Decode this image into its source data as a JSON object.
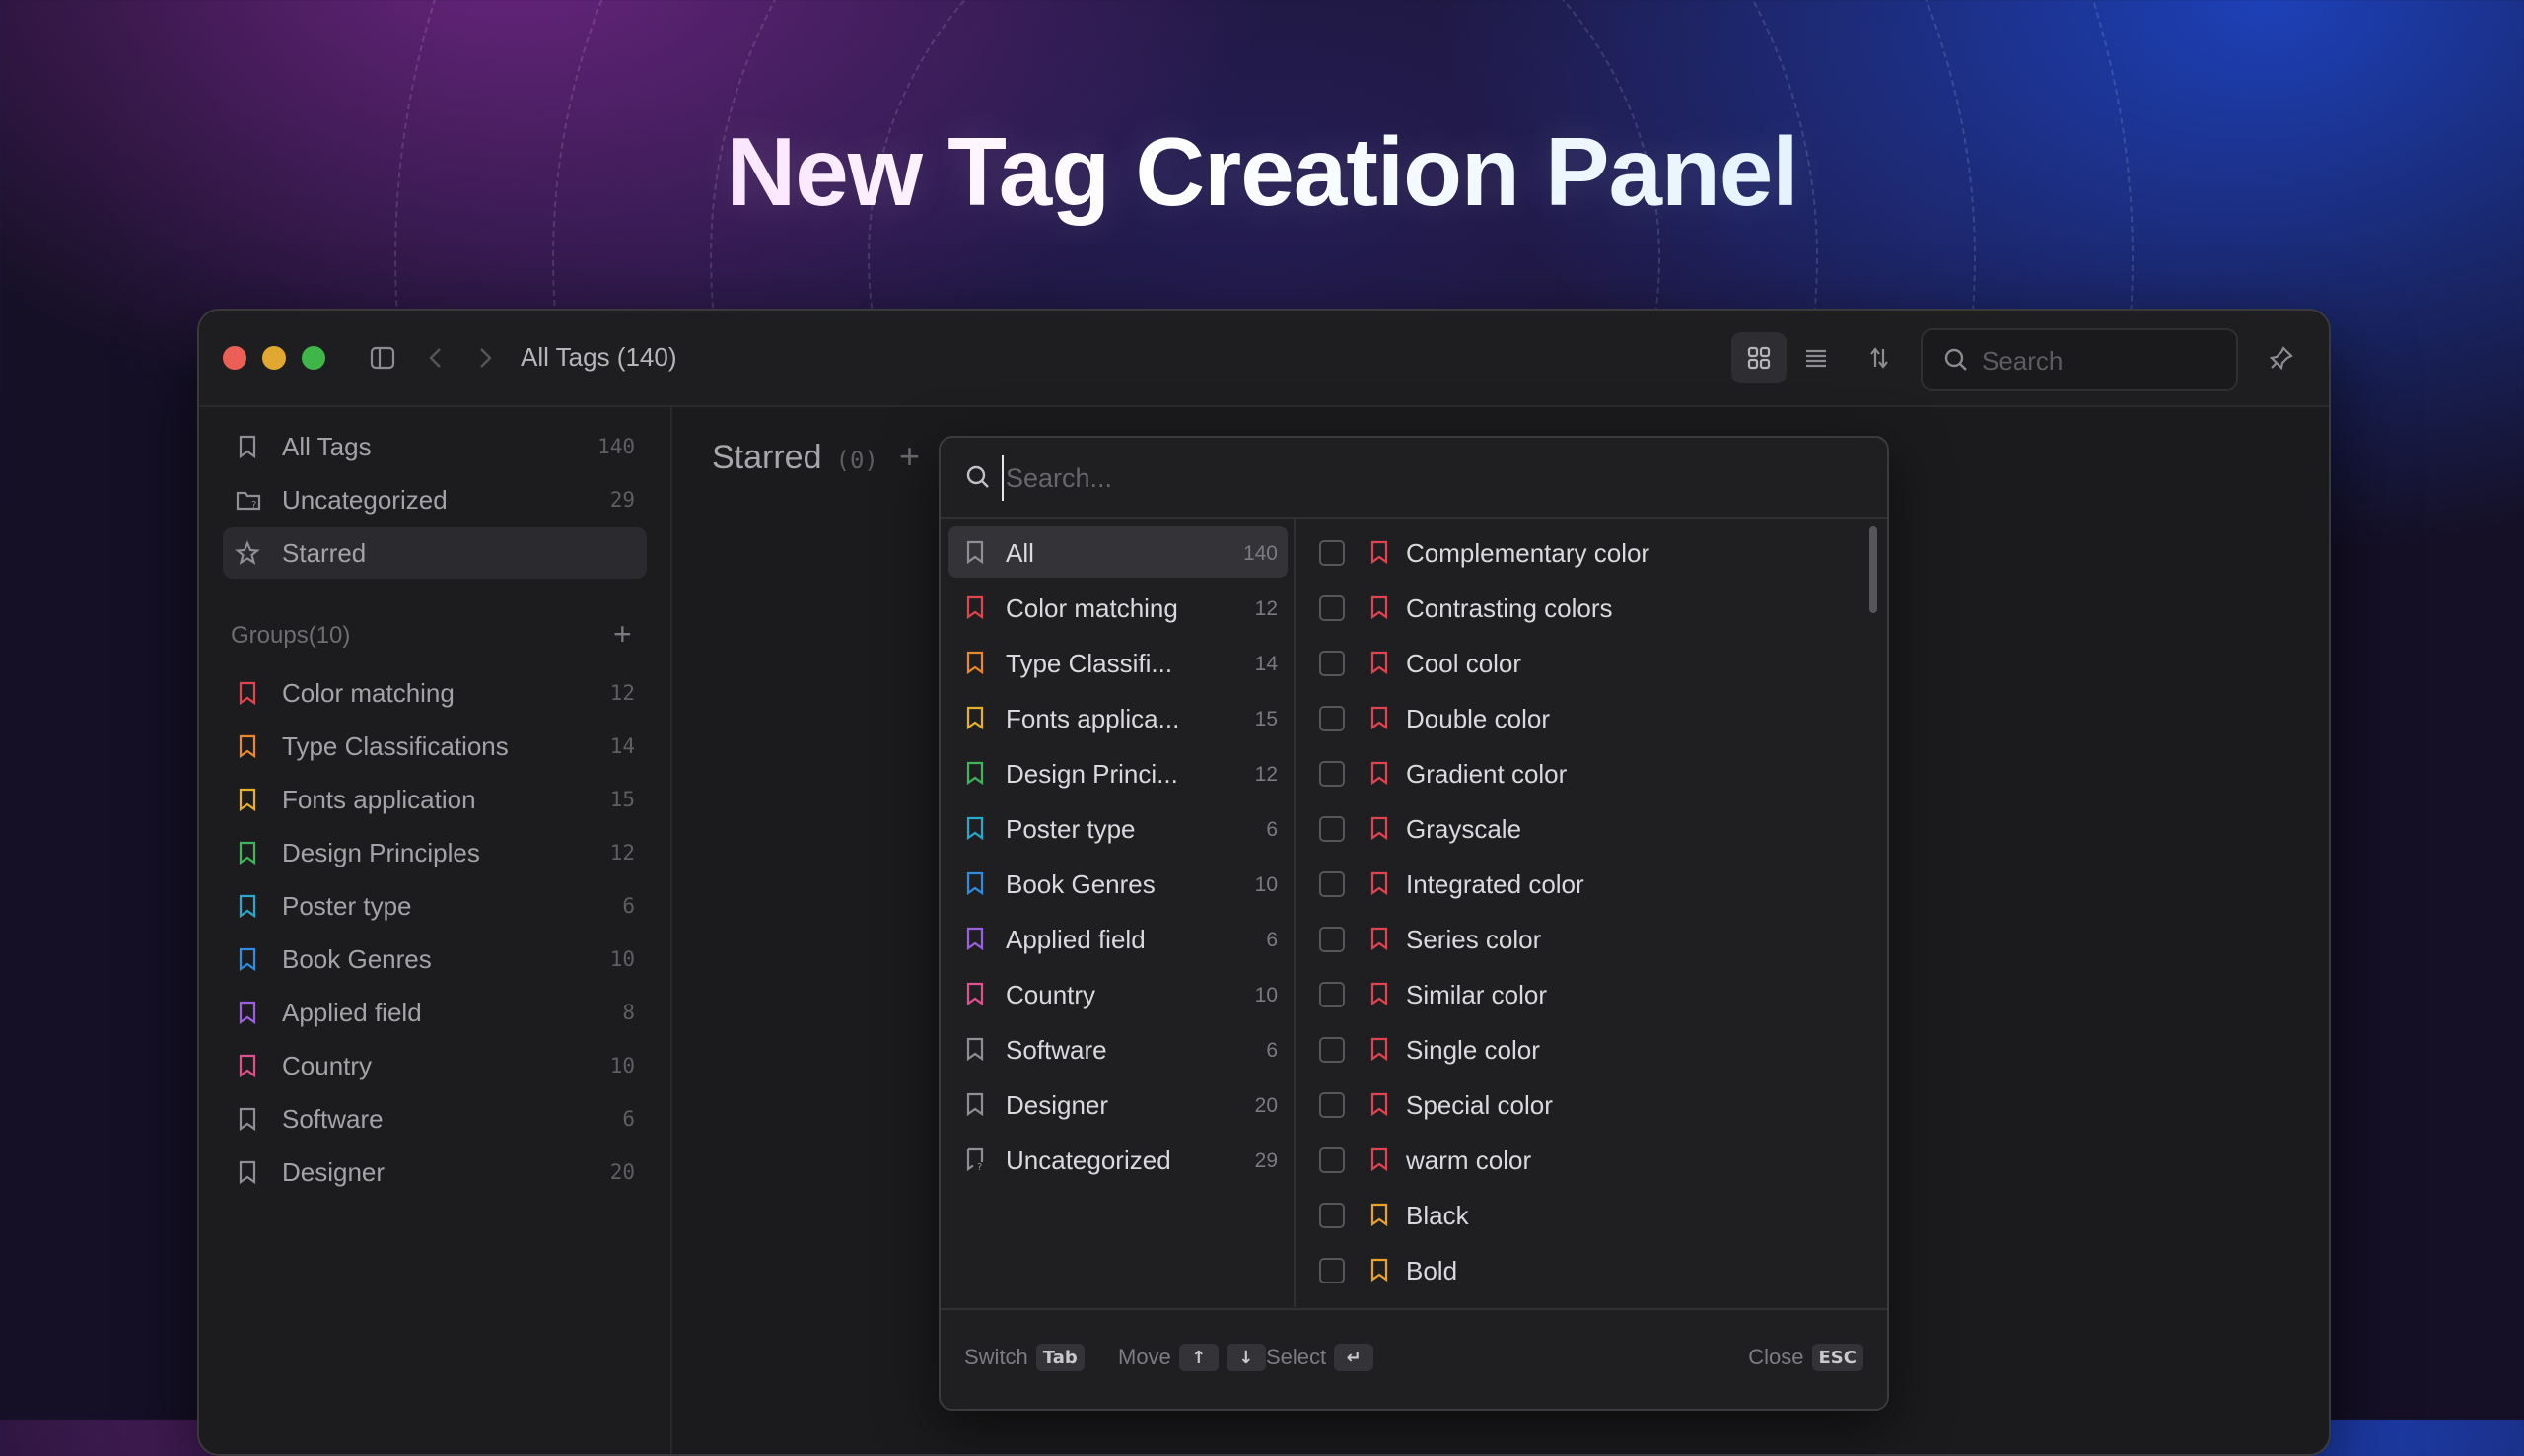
{
  "hero": {
    "title": "New Tag Creation Panel"
  },
  "window": {
    "title": "All Tags (140)",
    "search_placeholder": "Search"
  },
  "sidebar": {
    "top": [
      {
        "label": "All Tags",
        "count": "140",
        "icon": "bookmark-icon"
      },
      {
        "label": "Uncategorized",
        "count": "29",
        "icon": "folder-question-icon"
      },
      {
        "label": "Starred",
        "count": "",
        "icon": "star-icon"
      }
    ],
    "groups_label": "Groups(10)",
    "groups": [
      {
        "label": "Color matching",
        "count": "12",
        "color": "#e0454f"
      },
      {
        "label": "Type Classifications",
        "count": "14",
        "color": "#e8882a"
      },
      {
        "label": "Fonts application",
        "count": "15",
        "color": "#e6b02a"
      },
      {
        "label": "Design Principles",
        "count": "12",
        "color": "#3fb45a"
      },
      {
        "label": "Poster type",
        "count": "6",
        "color": "#2aa7c9"
      },
      {
        "label": "Book Genres",
        "count": "10",
        "color": "#2f8de0"
      },
      {
        "label": "Applied field",
        "count": "8",
        "color": "#9b5fe0"
      },
      {
        "label": "Country",
        "count": "10",
        "color": "#e0508f"
      },
      {
        "label": "Software",
        "count": "6",
        "color": "#8e8e94"
      },
      {
        "label": "Designer",
        "count": "20",
        "color": "#8e8e94"
      }
    ]
  },
  "main": {
    "title": "Starred",
    "count": "(0)"
  },
  "panel": {
    "search_placeholder": "Search...",
    "groups": [
      {
        "label": "All",
        "count": "140",
        "color": "#8e8e94"
      },
      {
        "label": "Color matching",
        "count": "12",
        "color": "#e0454f"
      },
      {
        "label": "Type Classifi...",
        "count": "14",
        "color": "#e8882a"
      },
      {
        "label": "Fonts applica...",
        "count": "15",
        "color": "#e6b02a"
      },
      {
        "label": "Design Princi...",
        "count": "12",
        "color": "#3fb45a"
      },
      {
        "label": "Poster type",
        "count": "6",
        "color": "#2aa7c9"
      },
      {
        "label": "Book Genres",
        "count": "10",
        "color": "#2f8de0"
      },
      {
        "label": "Applied field",
        "count": "6",
        "color": "#9b5fe0"
      },
      {
        "label": "Country",
        "count": "10",
        "color": "#e0508f"
      },
      {
        "label": "Software",
        "count": "6",
        "color": "#8e8e94"
      },
      {
        "label": "Designer",
        "count": "20",
        "color": "#8e8e94"
      },
      {
        "label": "Uncategorized",
        "count": "29",
        "color": "#8e8e94"
      }
    ],
    "tags": [
      {
        "label": "Complementary color",
        "color": "#e0454f"
      },
      {
        "label": "Contrasting colors",
        "color": "#e0454f"
      },
      {
        "label": "Cool color",
        "color": "#e0454f"
      },
      {
        "label": "Double color",
        "color": "#e0454f"
      },
      {
        "label": "Gradient color",
        "color": "#e0454f"
      },
      {
        "label": "Grayscale",
        "color": "#e0454f"
      },
      {
        "label": "Integrated color",
        "color": "#e0454f"
      },
      {
        "label": "Series color",
        "color": "#e0454f"
      },
      {
        "label": "Similar color",
        "color": "#e0454f"
      },
      {
        "label": "Single color",
        "color": "#e0454f"
      },
      {
        "label": "Special color",
        "color": "#e0454f"
      },
      {
        "label": "warm color",
        "color": "#e0454f"
      },
      {
        "label": "Black",
        "color": "#e8a22a"
      },
      {
        "label": "Bold",
        "color": "#e8a22a"
      }
    ],
    "footer": {
      "switch_label": "Switch",
      "switch_key": "Tab",
      "move_label": "Move",
      "move_up_key": "↑",
      "move_down_key": "↓",
      "select_label": "Select",
      "select_key": "↵",
      "close_label": "Close",
      "close_key": "ESC"
    }
  }
}
